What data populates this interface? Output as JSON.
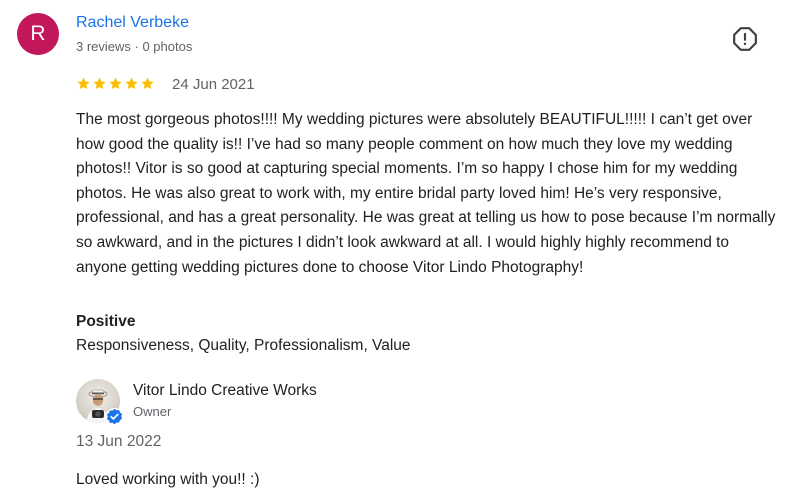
{
  "reviewer": {
    "initial": "R",
    "name": "Rachel Verbeke",
    "meta": "3 reviews · 0 photos",
    "avatar_color": "#c2185b"
  },
  "report_icon": "report-flag-icon",
  "review": {
    "rating": 5,
    "max_rating": 5,
    "star_color": "#fbbc04",
    "date": "24 Jun 2021",
    "text": "The most gorgeous photos!!!! My wedding pictures were absolutely BEAUTIFUL!!!!! I can’t get over how good the quality is!! I’ve had so many people comment on how much they love my wedding photos!! Vitor is so good at capturing special moments. I’m so happy I chose him for my wedding photos. He was also great to work with, my entire bridal party loved him! He’s very responsive, professional, and has a great personality. He was great at telling us how to pose because I’m normally so awkward, and in the pictures I didn’t look awkward at all. I would highly highly recommend to anyone getting wedding pictures done to choose Vitor Lindo Photography!"
  },
  "positive": {
    "heading": "Positive",
    "attributes": "Responsiveness, Quality, Professionalism, Value"
  },
  "owner_reply": {
    "name": "Vitor Lindo Creative Works",
    "role": "Owner",
    "date": "13 Jun 2022",
    "text": "Loved working with you!! :)",
    "verified_color": "#1a73e8"
  }
}
